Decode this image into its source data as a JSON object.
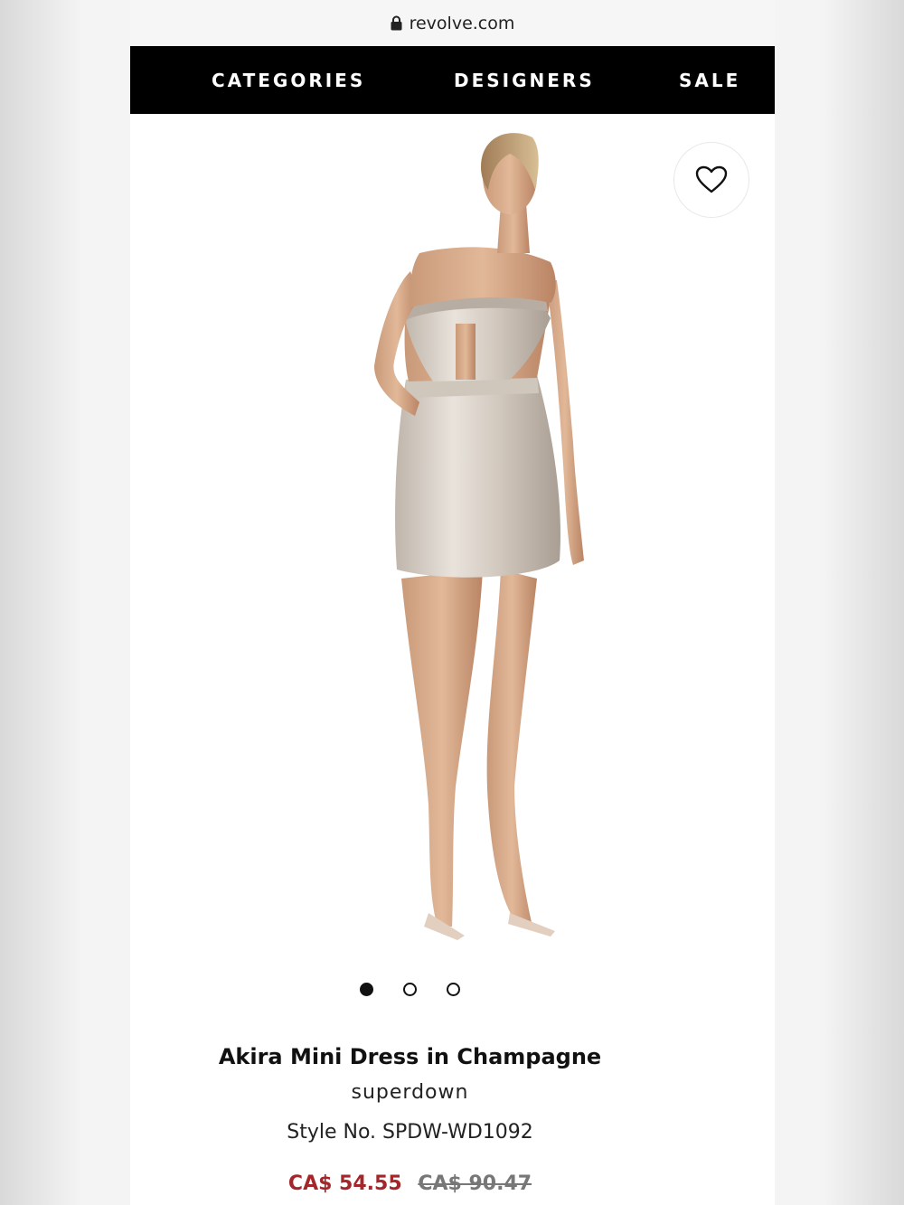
{
  "browser": {
    "url": "revolve.com"
  },
  "nav": {
    "items": [
      "CATEGORIES",
      "DESIGNERS",
      "SALE"
    ]
  },
  "gallery": {
    "image_count": 3,
    "active_index": 0
  },
  "product": {
    "name": "Akira Mini Dress in Champagne",
    "brand": "superdown",
    "style_no": "Style No. SPDW-WD1092",
    "sale_price": "CA$ 54.55",
    "original_price": "CA$ 90.47"
  },
  "colors": {
    "nav_bg": "#000000",
    "sale_price": "#a3262a",
    "original_price": "#777777"
  },
  "icons": {
    "lock": "lock-icon",
    "favorite": "heart-icon"
  }
}
